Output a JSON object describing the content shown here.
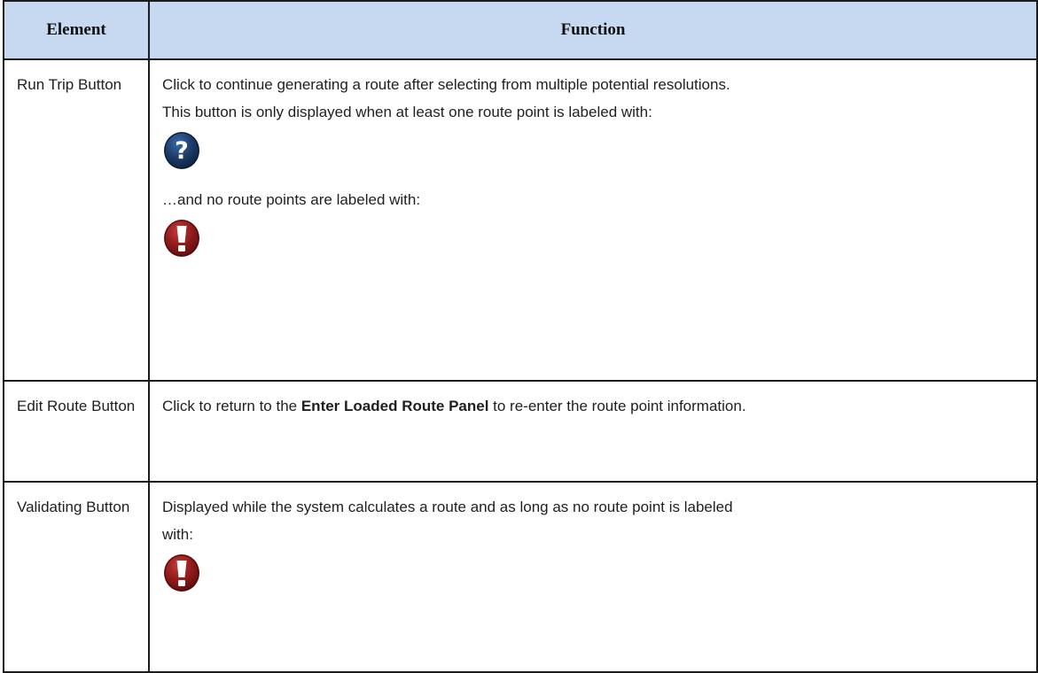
{
  "table": {
    "headers": {
      "element": "Element",
      "function": "Function"
    },
    "rows": [
      {
        "element": "Run Trip Button",
        "line1": "Click to continue generating a route after selecting from multiple potential resolutions.",
        "line2": "This button is only displayed when at least one route point is labeled with:",
        "icon1": "question-mark-icon",
        "line3": "…and no route points are labeled with:",
        "icon2": "exclamation-mark-icon"
      },
      {
        "element": "Edit Route Button",
        "before": "Click to return to the ",
        "bold": "Enter Loaded Route Panel",
        "after": " to re-enter the route point information."
      },
      {
        "element": "Validating Button",
        "line1": "Displayed while the system calculates a route and as long as no route point is labeled",
        "line2": "with:",
        "icon1": "exclamation-mark-icon"
      }
    ]
  },
  "colors": {
    "header_bg": "#c7d9f1",
    "question_icon": "#1c3a66",
    "exclamation_icon": "#8e1a1a"
  }
}
